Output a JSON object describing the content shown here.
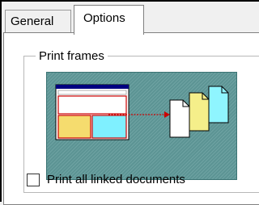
{
  "tabs": [
    {
      "label": "General",
      "selected": false
    },
    {
      "label": "Options",
      "selected": true
    }
  ],
  "print_frames": {
    "title": "Print frames",
    "illustration_colors": {
      "background": "#5c9494",
      "window_border": "#000080",
      "yellow_frame": "#f5dc6e",
      "cyan_frame": "#7ff0ff",
      "arrow": "#cc0000",
      "page_white": "#ffffff",
      "page_yellow": "#f5ef8a",
      "page_cyan": "#8ff5ff"
    }
  },
  "print_linked": {
    "label": "Print all linked documents",
    "checked": false
  }
}
